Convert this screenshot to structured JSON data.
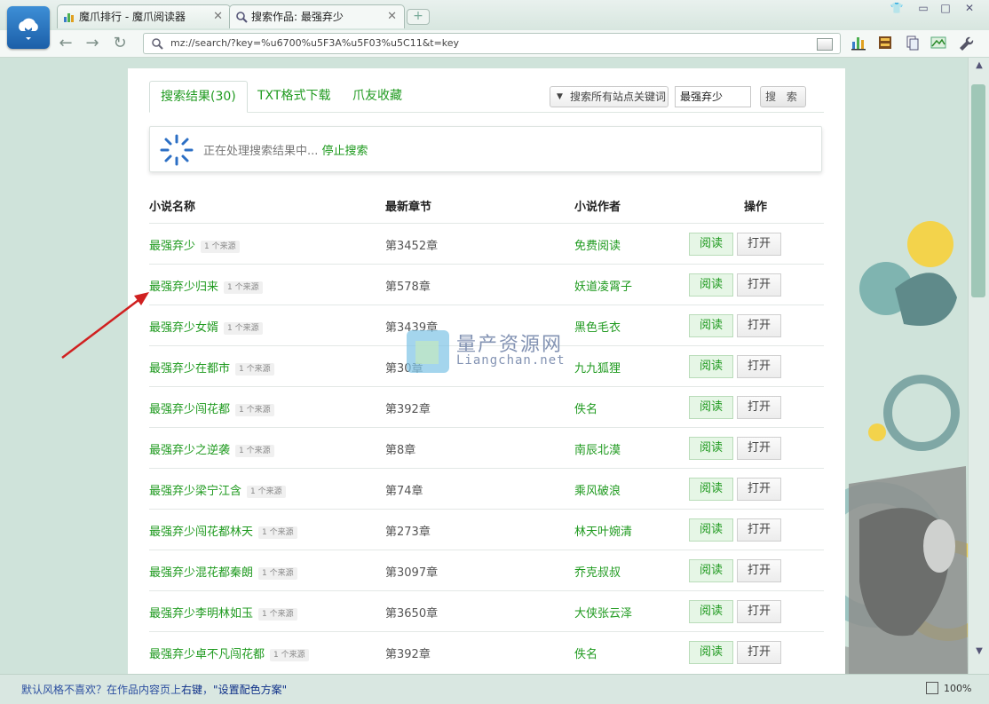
{
  "window": {
    "tabs": [
      {
        "label": "魔爪排行 - 魔爪阅读器",
        "icon": "bar-chart-icon"
      },
      {
        "label": "搜索作品: 最强弃少",
        "icon": "search-icon"
      }
    ],
    "new_tab_label": "+"
  },
  "address_bar": {
    "url": "mz://search/?key=%u6700%u5F3A%u5F03%u5C11&t=key"
  },
  "panel": {
    "tabs": [
      "搜索结果(30)",
      "TXT格式下载",
      "爪友收藏"
    ],
    "search": {
      "dropdown_label": "搜索所有站点关键词",
      "keyword": "最强弃少",
      "button_label": "搜 索"
    },
    "status": {
      "text": "正在处理搜索结果中... ",
      "stop_link": "停止搜索"
    },
    "table": {
      "headers": [
        "小说名称",
        "最新章节",
        "小说作者",
        "操作"
      ],
      "read_label": "阅读",
      "open_label": "打开",
      "rows": [
        {
          "name": "最强弃少",
          "sources": "1 个来源",
          "chapter": "第3452章",
          "author": "免费阅读"
        },
        {
          "name": "最强弃少归来",
          "sources": "1 个来源",
          "chapter": "第578章",
          "author": "妖道凌霄子"
        },
        {
          "name": "最强弃少女婿",
          "sources": "1 个来源",
          "chapter": "第3439章",
          "author": "黑色毛衣"
        },
        {
          "name": "最强弃少在都市",
          "sources": "1 个来源",
          "chapter": "第30章",
          "author": "九九狐狸"
        },
        {
          "name": "最强弃少闯花都",
          "sources": "1 个来源",
          "chapter": "第392章",
          "author": "佚名"
        },
        {
          "name": "最强弃少之逆袭",
          "sources": "1 个来源",
          "chapter": "第8章",
          "author": "南辰北漠"
        },
        {
          "name": "最强弃少梁宁江含",
          "sources": "1 个来源",
          "chapter": "第74章",
          "author": "乘风破浪"
        },
        {
          "name": "最强弃少闯花都林天",
          "sources": "1 个来源",
          "chapter": "第273章",
          "author": "林天叶婉清"
        },
        {
          "name": "最强弃少混花都秦朗",
          "sources": "1 个来源",
          "chapter": "第3097章",
          "author": "乔克叔叔"
        },
        {
          "name": "最强弃少李明林如玉",
          "sources": "1 个来源",
          "chapter": "第3650章",
          "author": "大侠张云泽"
        },
        {
          "name": "最强弃少卓不凡闯花都",
          "sources": "1 个来源",
          "chapter": "第392章",
          "author": "佚名"
        }
      ]
    }
  },
  "watermark": {
    "title": "量产资源网",
    "url": "Liangchan.net"
  },
  "bottom_bar": {
    "tip_prefix": "默认风格不喜欢？在作品内容页上",
    "tip_em1": "右键",
    "tip_mid": "，",
    "tip_em2": "\"设置配色方案\"",
    "zoom": "100%"
  },
  "colors": {
    "accent": "#1f9a1f",
    "background": "#cfe3da",
    "link_blue": "#2c4fa0"
  }
}
